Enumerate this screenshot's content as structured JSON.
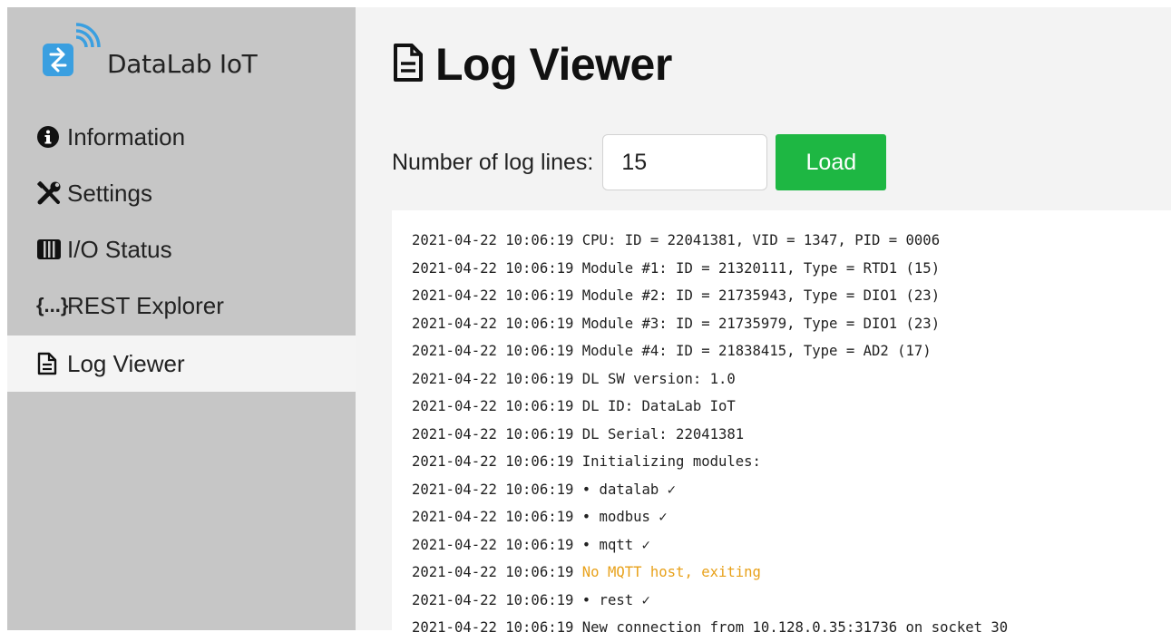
{
  "app": {
    "brand_name": "DataLab IoT",
    "logo_icon": "datalab-wifi-logo-icon"
  },
  "sidebar": {
    "items": [
      {
        "label": "Information",
        "icon": "info-circle-icon",
        "active": false
      },
      {
        "label": "Settings",
        "icon": "tools-icon",
        "active": false
      },
      {
        "label": "I/O Status",
        "icon": "io-columns-icon",
        "active": false
      },
      {
        "label": "REST Explorer",
        "icon": "braces-icon",
        "icon_text": "{...}",
        "active": false
      },
      {
        "label": "Log Viewer",
        "icon": "document-icon",
        "active": true
      }
    ]
  },
  "page": {
    "title": "Log Viewer",
    "title_icon": "document-icon"
  },
  "controls": {
    "lines_label": "Number of log lines:",
    "lines_value": "15",
    "load_label": "Load"
  },
  "colors": {
    "accent_button": "#1eb743",
    "warning_text": "#e8a11a",
    "brand_icon": "#3a9fe0"
  },
  "log": {
    "lines": [
      {
        "time": "2021-04-22 10:06:19",
        "msg": "CPU: ID = 22041381, VID = 1347, PID = 0006",
        "level": "info"
      },
      {
        "time": "2021-04-22 10:06:19",
        "msg": "Module #1: ID = 21320111, Type = RTD1 (15)",
        "level": "info"
      },
      {
        "time": "2021-04-22 10:06:19",
        "msg": "Module #2: ID = 21735943, Type = DIO1 (23)",
        "level": "info"
      },
      {
        "time": "2021-04-22 10:06:19",
        "msg": "Module #3: ID = 21735979, Type = DIO1 (23)",
        "level": "info"
      },
      {
        "time": "2021-04-22 10:06:19",
        "msg": "Module #4: ID = 21838415, Type = AD2 (17)",
        "level": "info"
      },
      {
        "time": "2021-04-22 10:06:19",
        "msg": "DL SW version: 1.0",
        "level": "info"
      },
      {
        "time": "2021-04-22 10:06:19",
        "msg": "DL ID: DataLab IoT",
        "level": "info"
      },
      {
        "time": "2021-04-22 10:06:19",
        "msg": "DL Serial: 22041381",
        "level": "info"
      },
      {
        "time": "2021-04-22 10:06:19",
        "msg": "Initializing modules:",
        "level": "info"
      },
      {
        "time": "2021-04-22 10:06:19",
        "msg": "• datalab ✓",
        "level": "info"
      },
      {
        "time": "2021-04-22 10:06:19",
        "msg": "• modbus ✓",
        "level": "info"
      },
      {
        "time": "2021-04-22 10:06:19",
        "msg": "• mqtt ✓",
        "level": "info"
      },
      {
        "time": "2021-04-22 10:06:19",
        "msg": "No MQTT host, exiting",
        "level": "warning"
      },
      {
        "time": "2021-04-22 10:06:19",
        "msg": "• rest ✓",
        "level": "info"
      },
      {
        "time": "2021-04-22 10:06:19",
        "msg": "New connection from 10.128.0.35:31736 on socket 30",
        "level": "info"
      }
    ]
  }
}
